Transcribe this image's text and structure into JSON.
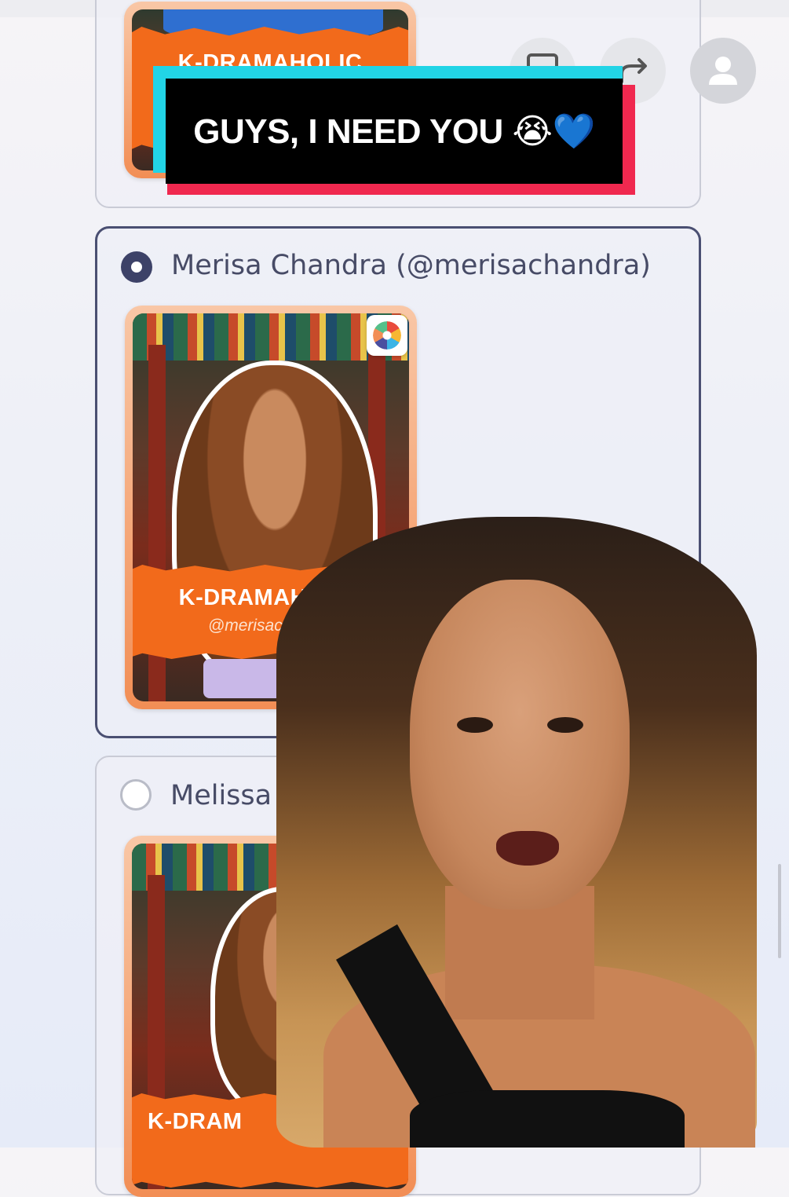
{
  "caption": {
    "text": "GUYS, I NEED YOU 😭💙"
  },
  "action_buttons": {
    "icons": [
      "bookmark-icon",
      "share-icon",
      "user-icon"
    ]
  },
  "poll": {
    "candidates": [
      {
        "name": "",
        "selected": false,
        "card": {
          "banner_title": "K-DRAMAHOLIC",
          "handle": ""
        }
      },
      {
        "name": "Merisa Chandra (@merisachandra)",
        "selected": true,
        "card": {
          "banner_title": "K-DRAMAHOLIC",
          "handle": "@merisachandra"
        }
      },
      {
        "name": "Melissa Lau (",
        "selected": false,
        "card": {
          "banner_title": "K-DRAM",
          "handle": ""
        }
      }
    ]
  },
  "colors": {
    "accent_orange": "#f26a1b",
    "selected_border": "#4a4f72",
    "caption_cyan": "#22d4e6",
    "caption_red": "#f0284f"
  }
}
